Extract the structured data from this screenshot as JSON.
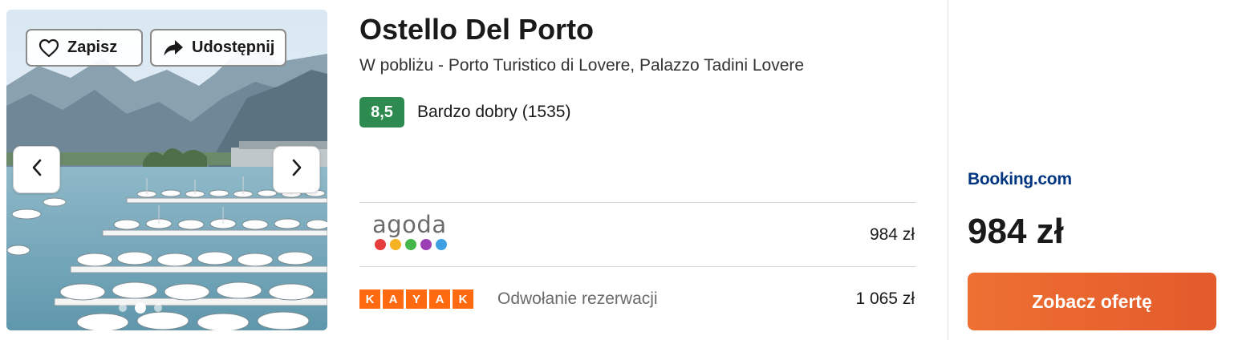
{
  "gallery": {
    "save_label": "Zapisz",
    "share_label": "Udostępnij",
    "icons": {
      "save": "heart-icon",
      "share": "share-arrow-icon",
      "prev": "chevron-left-icon",
      "next": "chevron-right-icon"
    },
    "dots_count": 3,
    "active_dot": 2
  },
  "hotel": {
    "name": "Ostello Del Porto",
    "location": "W pobliżu - Porto Turistico di Lovere, Palazzo Tadini Lovere",
    "rating_score": "8,5",
    "rating_label": "Bardzo dobry (1535)",
    "rating_color": "#2e8b4f"
  },
  "offers": [
    {
      "provider": "agoda",
      "logo_text": "agoda",
      "logo_dot_colors": [
        "#e63e3e",
        "#f5b324",
        "#45b649",
        "#9c3fb5",
        "#3ea0e2"
      ],
      "note": "",
      "price": "984 zł"
    },
    {
      "provider": "kayak",
      "logo_letters": [
        "K",
        "A",
        "Y",
        "A",
        "K"
      ],
      "logo_color": "#ff690f",
      "note": "Odwołanie rezerwacji",
      "price": "1 065 zł"
    }
  ],
  "deal": {
    "provider": "Booking.com",
    "provider_color": "#003580",
    "price": "984 zł",
    "cta_label": "Zobacz ofertę",
    "cta_color": "#e8622d"
  }
}
